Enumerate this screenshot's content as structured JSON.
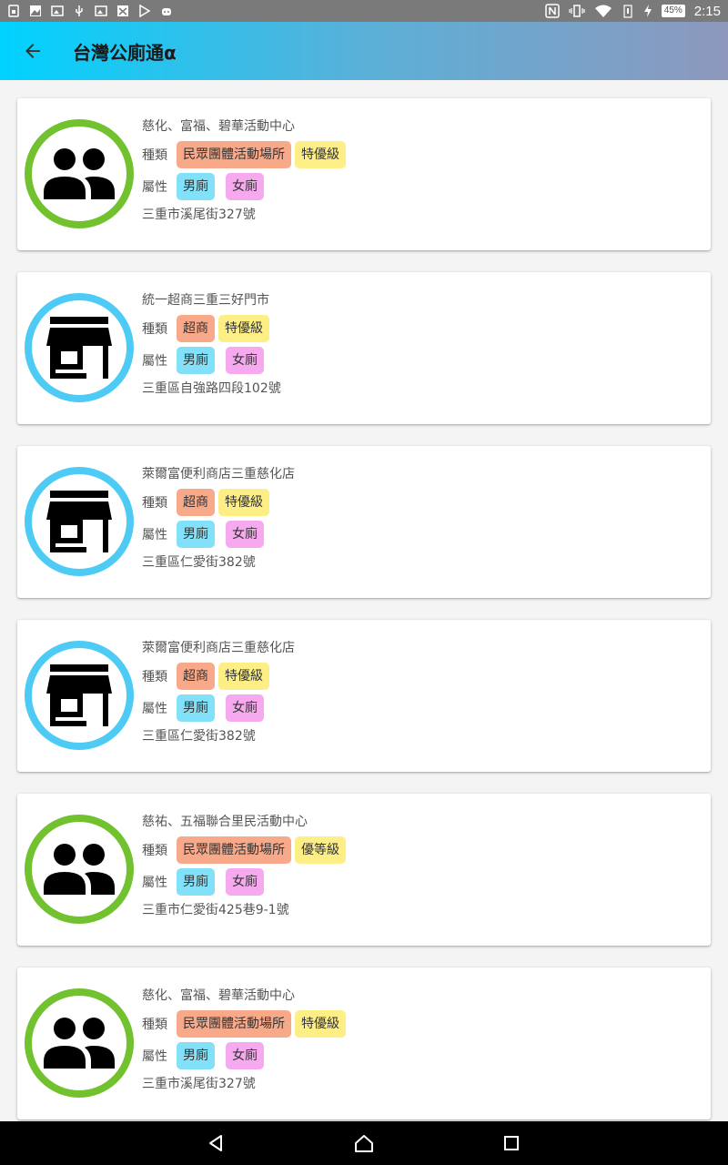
{
  "status_bar": {
    "battery": "45%",
    "time": "2:15"
  },
  "app_bar": {
    "title": "台灣公廁通α"
  },
  "labels": {
    "type": "種類",
    "attr": "屬性"
  },
  "cards": [
    {
      "icon": "people-icon",
      "ring": "#72c12f",
      "name": "慈化、富福、碧華活動中心",
      "type": "民眾團體活動場所",
      "grade": "特優級",
      "male": "男廁",
      "female": "女廁",
      "address": "三重市溪尾街327號"
    },
    {
      "icon": "store-icon",
      "ring": "#4dcbf4",
      "name": "統一超商三重三好門市",
      "type": "超商",
      "grade": "特優級",
      "male": "男廁",
      "female": "女廁",
      "address": "三重區自強路四段102號"
    },
    {
      "icon": "store-icon",
      "ring": "#4dcbf4",
      "name": "萊爾富便利商店三重慈化店",
      "type": "超商",
      "grade": "特優級",
      "male": "男廁",
      "female": "女廁",
      "address": "三重區仁愛街382號"
    },
    {
      "icon": "store-icon",
      "ring": "#4dcbf4",
      "name": "萊爾富便利商店三重慈化店",
      "type": "超商",
      "grade": "特優級",
      "male": "男廁",
      "female": "女廁",
      "address": "三重區仁愛街382號"
    },
    {
      "icon": "people-icon",
      "ring": "#72c12f",
      "name": "慈祐、五福聯合里民活動中心",
      "type": "民眾團體活動場所",
      "grade": "優等級",
      "male": "男廁",
      "female": "女廁",
      "address": "三重市仁愛街425巷9-1號"
    },
    {
      "icon": "people-icon",
      "ring": "#72c12f",
      "name": "慈化、富福、碧華活動中心",
      "type": "民眾團體活動場所",
      "grade": "特優級",
      "male": "男廁",
      "female": "女廁",
      "address": "三重市溪尾街327號"
    }
  ],
  "colors": {
    "type_chip": "#f8a98a",
    "grade_chip": "#fdee85",
    "male_chip": "#82e0f8",
    "female_chip": "#f6a9ef"
  }
}
